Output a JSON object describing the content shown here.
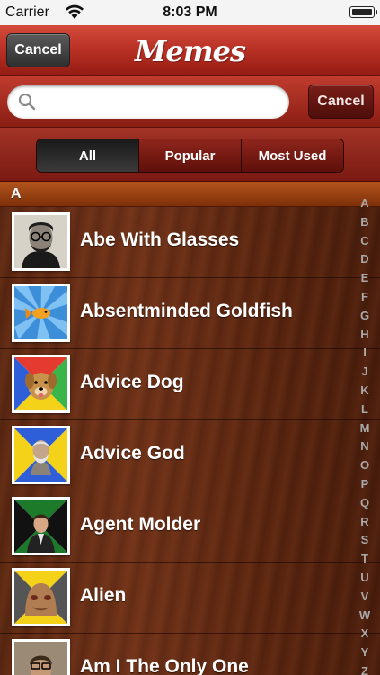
{
  "status_bar": {
    "carrier": "Carrier",
    "time": "8:03 PM"
  },
  "nav": {
    "cancel_label": "Cancel",
    "title": "Memes"
  },
  "search": {
    "value": "",
    "placeholder": "",
    "cancel_label": "Cancel"
  },
  "scope": {
    "segments": [
      "All",
      "Popular",
      "Most Used"
    ],
    "selected": "All"
  },
  "section": {
    "title": "A"
  },
  "items": [
    {
      "label": "Abe With Glasses",
      "icon": "abe-with-glasses-thumbnail"
    },
    {
      "label": "Absentminded Goldfish",
      "icon": "absentminded-goldfish-thumbnail"
    },
    {
      "label": "Advice Dog",
      "icon": "advice-dog-thumbnail"
    },
    {
      "label": "Advice God",
      "icon": "advice-god-thumbnail"
    },
    {
      "label": "Agent Molder",
      "icon": "agent-molder-thumbnail"
    },
    {
      "label": "Alien",
      "icon": "alien-thumbnail"
    },
    {
      "label": "Am I The Only One",
      "icon": "am-i-the-only-one-thumbnail"
    }
  ],
  "index_letters": [
    "A",
    "B",
    "C",
    "D",
    "E",
    "F",
    "G",
    "H",
    "I",
    "J",
    "K",
    "L",
    "M",
    "N",
    "O",
    "P",
    "Q",
    "R",
    "S",
    "T",
    "U",
    "V",
    "W",
    "X",
    "Y",
    "Z"
  ],
  "colors": {
    "nav_red": "#b52e22",
    "scope_selected": "#1a1a1a",
    "section_orange": "#b3541c",
    "wood": "#5c2812"
  }
}
